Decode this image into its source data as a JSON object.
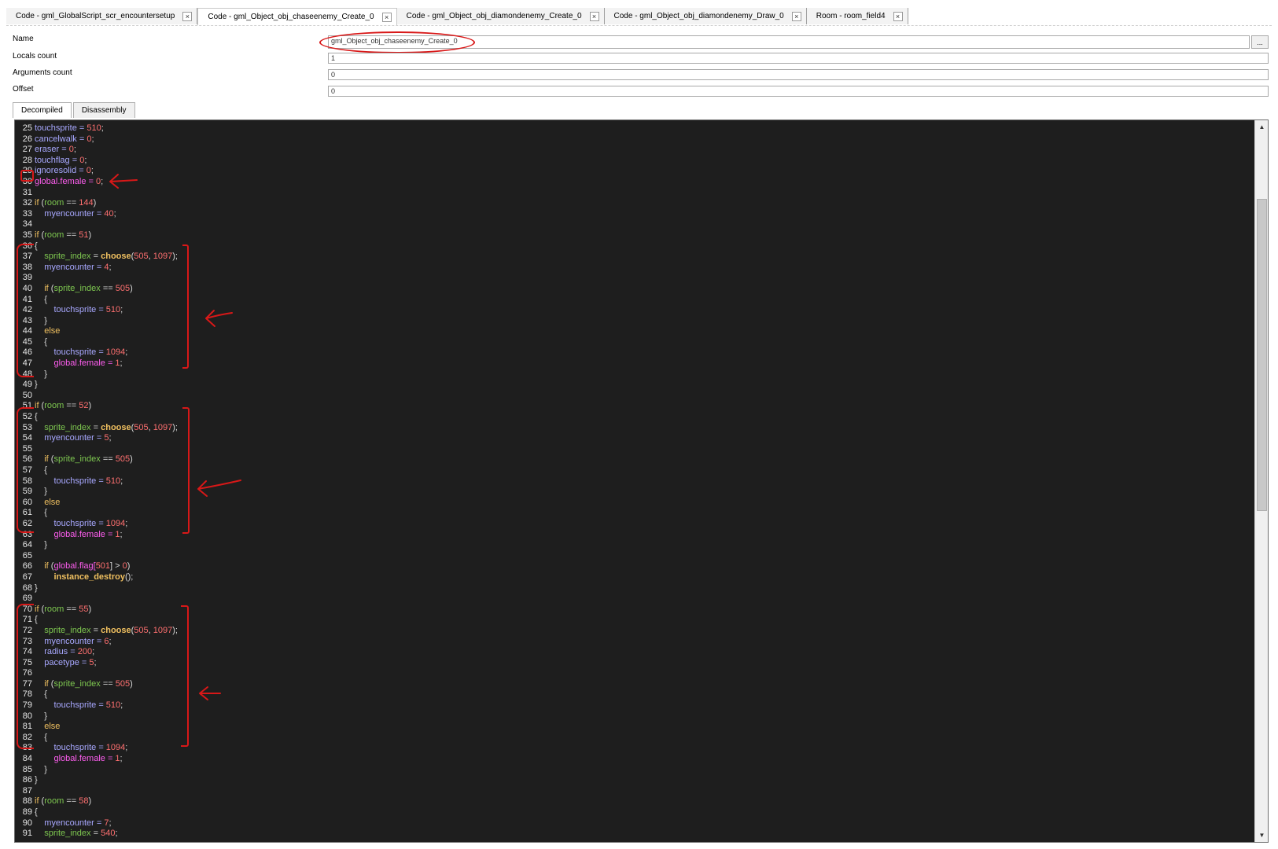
{
  "tabs": [
    {
      "label": "Code - gml_GlobalScript_scr_encountersetup",
      "active": false
    },
    {
      "label": "Code - gml_Object_obj_chaseenemy_Create_0",
      "active": true
    },
    {
      "label": "Code - gml_Object_obj_diamondenemy_Create_0",
      "active": false
    },
    {
      "label": "Code - gml_Object_obj_diamondenemy_Draw_0",
      "active": false
    },
    {
      "label": "Room - room_field4",
      "active": false
    }
  ],
  "close_glyph": "×",
  "properties": {
    "name_label": "Name",
    "name_value": "gml_Object_obj_chaseenemy_Create_0",
    "browse_label": "...",
    "locals_label": "Locals count",
    "locals_value": "1",
    "args_label": "Arguments count",
    "args_value": "0",
    "offset_label": "Offset",
    "offset_value": "0"
  },
  "view_tabs": {
    "decompiled": "Decompiled",
    "disassembly": "Disassembly"
  },
  "code_lines": [
    {
      "n": "25",
      "t": [
        [
          "touchsprite = ",
          "v"
        ],
        [
          "510",
          "num"
        ],
        [
          ";",
          "pl"
        ]
      ]
    },
    {
      "n": "26",
      "t": [
        [
          "cancelwalk = ",
          "v"
        ],
        [
          "0",
          "num"
        ],
        [
          ";",
          "pl"
        ]
      ]
    },
    {
      "n": "27",
      "t": [
        [
          "eraser = ",
          "v"
        ],
        [
          "0",
          "num"
        ],
        [
          ";",
          "pl"
        ]
      ]
    },
    {
      "n": "28",
      "t": [
        [
          "touchflag = ",
          "v"
        ],
        [
          "0",
          "num"
        ],
        [
          ";",
          "pl"
        ]
      ]
    },
    {
      "n": "29",
      "t": [
        [
          "ignoresolid = ",
          "v"
        ],
        [
          "0",
          "num"
        ],
        [
          ";",
          "pl"
        ]
      ]
    },
    {
      "n": "30",
      "t": [
        [
          "global",
          "gl"
        ],
        [
          ".female = ",
          "gl"
        ],
        [
          "0",
          "num"
        ],
        [
          ";",
          "pl"
        ]
      ]
    },
    {
      "n": "31",
      "t": []
    },
    {
      "n": "32",
      "t": [
        [
          "if",
          "kw"
        ],
        [
          " (",
          "pl"
        ],
        [
          "room",
          "bi"
        ],
        [
          " == ",
          "pl"
        ],
        [
          "144",
          "num"
        ],
        [
          ")",
          "pl"
        ]
      ]
    },
    {
      "n": "33",
      "t": [
        [
          "    myencounter = ",
          "v"
        ],
        [
          "40",
          "num"
        ],
        [
          ";",
          "pl"
        ]
      ]
    },
    {
      "n": "34",
      "t": []
    },
    {
      "n": "35",
      "t": [
        [
          "if",
          "kw"
        ],
        [
          " (",
          "pl"
        ],
        [
          "room",
          "bi"
        ],
        [
          " == ",
          "pl"
        ],
        [
          "51",
          "num"
        ],
        [
          ")",
          "pl"
        ]
      ]
    },
    {
      "n": "36",
      "t": [
        [
          "{",
          "pl"
        ]
      ]
    },
    {
      "n": "37",
      "t": [
        [
          "    ",
          "pl"
        ],
        [
          "sprite_index",
          "bi"
        ],
        [
          " = ",
          "pl"
        ],
        [
          "choose",
          "fn"
        ],
        [
          "(",
          "pl"
        ],
        [
          "505",
          "num"
        ],
        [
          ", ",
          "pl"
        ],
        [
          "1097",
          "num"
        ],
        [
          ");",
          "pl"
        ]
      ]
    },
    {
      "n": "38",
      "t": [
        [
          "    myencounter = ",
          "v"
        ],
        [
          "4",
          "num"
        ],
        [
          ";",
          "pl"
        ]
      ]
    },
    {
      "n": "39",
      "t": []
    },
    {
      "n": "40",
      "t": [
        [
          "    ",
          "pl"
        ],
        [
          "if",
          "kw"
        ],
        [
          " (",
          "pl"
        ],
        [
          "sprite_index",
          "bi"
        ],
        [
          " == ",
          "pl"
        ],
        [
          "505",
          "num"
        ],
        [
          ")",
          "pl"
        ]
      ]
    },
    {
      "n": "41",
      "t": [
        [
          "    {",
          "pl"
        ]
      ]
    },
    {
      "n": "42",
      "t": [
        [
          "        touchsprite = ",
          "v"
        ],
        [
          "510",
          "num"
        ],
        [
          ";",
          "pl"
        ]
      ]
    },
    {
      "n": "43",
      "t": [
        [
          "    }",
          "pl"
        ]
      ]
    },
    {
      "n": "44",
      "t": [
        [
          "    ",
          "pl"
        ],
        [
          "else",
          "kw"
        ]
      ]
    },
    {
      "n": "45",
      "t": [
        [
          "    {",
          "pl"
        ]
      ]
    },
    {
      "n": "46",
      "t": [
        [
          "        touchsprite = ",
          "v"
        ],
        [
          "1094",
          "num"
        ],
        [
          ";",
          "pl"
        ]
      ]
    },
    {
      "n": "47",
      "t": [
        [
          "        ",
          "pl"
        ],
        [
          "global",
          "gl"
        ],
        [
          ".female = ",
          "gl"
        ],
        [
          "1",
          "num"
        ],
        [
          ";",
          "pl"
        ]
      ]
    },
    {
      "n": "48",
      "t": [
        [
          "    }",
          "pl"
        ]
      ]
    },
    {
      "n": "49",
      "t": [
        [
          "}",
          "pl"
        ]
      ]
    },
    {
      "n": "50",
      "t": []
    },
    {
      "n": "51",
      "t": [
        [
          "if",
          "kw"
        ],
        [
          " (",
          "pl"
        ],
        [
          "room",
          "bi"
        ],
        [
          " == ",
          "pl"
        ],
        [
          "52",
          "num"
        ],
        [
          ")",
          "pl"
        ]
      ]
    },
    {
      "n": "52",
      "t": [
        [
          "{",
          "pl"
        ]
      ]
    },
    {
      "n": "53",
      "t": [
        [
          "    ",
          "pl"
        ],
        [
          "sprite_index",
          "bi"
        ],
        [
          " = ",
          "pl"
        ],
        [
          "choose",
          "fn"
        ],
        [
          "(",
          "pl"
        ],
        [
          "505",
          "num"
        ],
        [
          ", ",
          "pl"
        ],
        [
          "1097",
          "num"
        ],
        [
          ");",
          "pl"
        ]
      ]
    },
    {
      "n": "54",
      "t": [
        [
          "    myencounter = ",
          "v"
        ],
        [
          "5",
          "num"
        ],
        [
          ";",
          "pl"
        ]
      ]
    },
    {
      "n": "55",
      "t": []
    },
    {
      "n": "56",
      "t": [
        [
          "    ",
          "pl"
        ],
        [
          "if",
          "kw"
        ],
        [
          " (",
          "pl"
        ],
        [
          "sprite_index",
          "bi"
        ],
        [
          " == ",
          "pl"
        ],
        [
          "505",
          "num"
        ],
        [
          ")",
          "pl"
        ]
      ]
    },
    {
      "n": "57",
      "t": [
        [
          "    {",
          "pl"
        ]
      ]
    },
    {
      "n": "58",
      "t": [
        [
          "        touchsprite = ",
          "v"
        ],
        [
          "510",
          "num"
        ],
        [
          ";",
          "pl"
        ]
      ]
    },
    {
      "n": "59",
      "t": [
        [
          "    }",
          "pl"
        ]
      ]
    },
    {
      "n": "60",
      "t": [
        [
          "    ",
          "pl"
        ],
        [
          "else",
          "kw"
        ]
      ]
    },
    {
      "n": "61",
      "t": [
        [
          "    {",
          "pl"
        ]
      ]
    },
    {
      "n": "62",
      "t": [
        [
          "        touchsprite = ",
          "v"
        ],
        [
          "1094",
          "num"
        ],
        [
          ";",
          "pl"
        ]
      ]
    },
    {
      "n": "63",
      "t": [
        [
          "        ",
          "pl"
        ],
        [
          "global",
          "gl"
        ],
        [
          ".female = ",
          "gl"
        ],
        [
          "1",
          "num"
        ],
        [
          ";",
          "pl"
        ]
      ]
    },
    {
      "n": "64",
      "t": [
        [
          "    }",
          "pl"
        ]
      ]
    },
    {
      "n": "65",
      "t": []
    },
    {
      "n": "66",
      "t": [
        [
          "    ",
          "pl"
        ],
        [
          "if",
          "kw"
        ],
        [
          " (",
          "pl"
        ],
        [
          "global",
          "gl"
        ],
        [
          ".flag[",
          "gl"
        ],
        [
          "501",
          "num"
        ],
        [
          "] > ",
          "pl"
        ],
        [
          "0",
          "num"
        ],
        [
          ")",
          "pl"
        ]
      ]
    },
    {
      "n": "67",
      "t": [
        [
          "        ",
          "pl"
        ],
        [
          "instance_destroy",
          "fn"
        ],
        [
          "();",
          "pl"
        ]
      ]
    },
    {
      "n": "68",
      "t": [
        [
          "}",
          "pl"
        ]
      ]
    },
    {
      "n": "69",
      "t": []
    },
    {
      "n": "70",
      "t": [
        [
          "if",
          "kw"
        ],
        [
          " (",
          "pl"
        ],
        [
          "room",
          "bi"
        ],
        [
          " == ",
          "pl"
        ],
        [
          "55",
          "num"
        ],
        [
          ")",
          "pl"
        ]
      ]
    },
    {
      "n": "71",
      "t": [
        [
          "{",
          "pl"
        ]
      ]
    },
    {
      "n": "72",
      "t": [
        [
          "    ",
          "pl"
        ],
        [
          "sprite_index",
          "bi"
        ],
        [
          " = ",
          "pl"
        ],
        [
          "choose",
          "fn"
        ],
        [
          "(",
          "pl"
        ],
        [
          "505",
          "num"
        ],
        [
          ", ",
          "pl"
        ],
        [
          "1097",
          "num"
        ],
        [
          ");",
          "pl"
        ]
      ]
    },
    {
      "n": "73",
      "t": [
        [
          "    myencounter = ",
          "v"
        ],
        [
          "6",
          "num"
        ],
        [
          ";",
          "pl"
        ]
      ]
    },
    {
      "n": "74",
      "t": [
        [
          "    radius = ",
          "v"
        ],
        [
          "200",
          "num"
        ],
        [
          ";",
          "pl"
        ]
      ]
    },
    {
      "n": "75",
      "t": [
        [
          "    pacetype = ",
          "v"
        ],
        [
          "5",
          "num"
        ],
        [
          ";",
          "pl"
        ]
      ]
    },
    {
      "n": "76",
      "t": []
    },
    {
      "n": "77",
      "t": [
        [
          "    ",
          "pl"
        ],
        [
          "if",
          "kw"
        ],
        [
          " (",
          "pl"
        ],
        [
          "sprite_index",
          "bi"
        ],
        [
          " == ",
          "pl"
        ],
        [
          "505",
          "num"
        ],
        [
          ")",
          "pl"
        ]
      ]
    },
    {
      "n": "78",
      "t": [
        [
          "    {",
          "pl"
        ]
      ]
    },
    {
      "n": "79",
      "t": [
        [
          "        touchsprite = ",
          "v"
        ],
        [
          "510",
          "num"
        ],
        [
          ";",
          "pl"
        ]
      ]
    },
    {
      "n": "80",
      "t": [
        [
          "    }",
          "pl"
        ]
      ]
    },
    {
      "n": "81",
      "t": [
        [
          "    ",
          "pl"
        ],
        [
          "else",
          "kw"
        ]
      ]
    },
    {
      "n": "82",
      "t": [
        [
          "    {",
          "pl"
        ]
      ]
    },
    {
      "n": "83",
      "t": [
        [
          "        touchsprite = ",
          "v"
        ],
        [
          "1094",
          "num"
        ],
        [
          ";",
          "pl"
        ]
      ]
    },
    {
      "n": "84",
      "t": [
        [
          "        ",
          "pl"
        ],
        [
          "global",
          "gl"
        ],
        [
          ".female = ",
          "gl"
        ],
        [
          "1",
          "num"
        ],
        [
          ";",
          "pl"
        ]
      ]
    },
    {
      "n": "85",
      "t": [
        [
          "    }",
          "pl"
        ]
      ]
    },
    {
      "n": "86",
      "t": [
        [
          "}",
          "pl"
        ]
      ]
    },
    {
      "n": "87",
      "t": []
    },
    {
      "n": "88",
      "t": [
        [
          "if",
          "kw"
        ],
        [
          " (",
          "pl"
        ],
        [
          "room",
          "bi"
        ],
        [
          " == ",
          "pl"
        ],
        [
          "58",
          "num"
        ],
        [
          ")",
          "pl"
        ]
      ]
    },
    {
      "n": "89",
      "t": [
        [
          "{",
          "pl"
        ]
      ]
    },
    {
      "n": "90",
      "t": [
        [
          "    myencounter = ",
          "v"
        ],
        [
          "7",
          "num"
        ],
        [
          ";",
          "pl"
        ]
      ]
    },
    {
      "n": "91",
      "t": [
        [
          "    ",
          "pl"
        ],
        [
          "sprite_index",
          "bi"
        ],
        [
          " = ",
          "pl"
        ],
        [
          "540",
          "num"
        ],
        [
          ";",
          "pl"
        ]
      ]
    }
  ],
  "scroll": {
    "up_glyph": "▲",
    "down_glyph": "▼"
  },
  "annotation_color": "#d81818",
  "syntax_colors": {
    "variable": "#a8a8ff",
    "keyword": "#f0c060",
    "number": "#ff7070",
    "builtin": "#7ec850",
    "global": "#ff5ef0",
    "editor_bg": "#1e1e1e"
  }
}
